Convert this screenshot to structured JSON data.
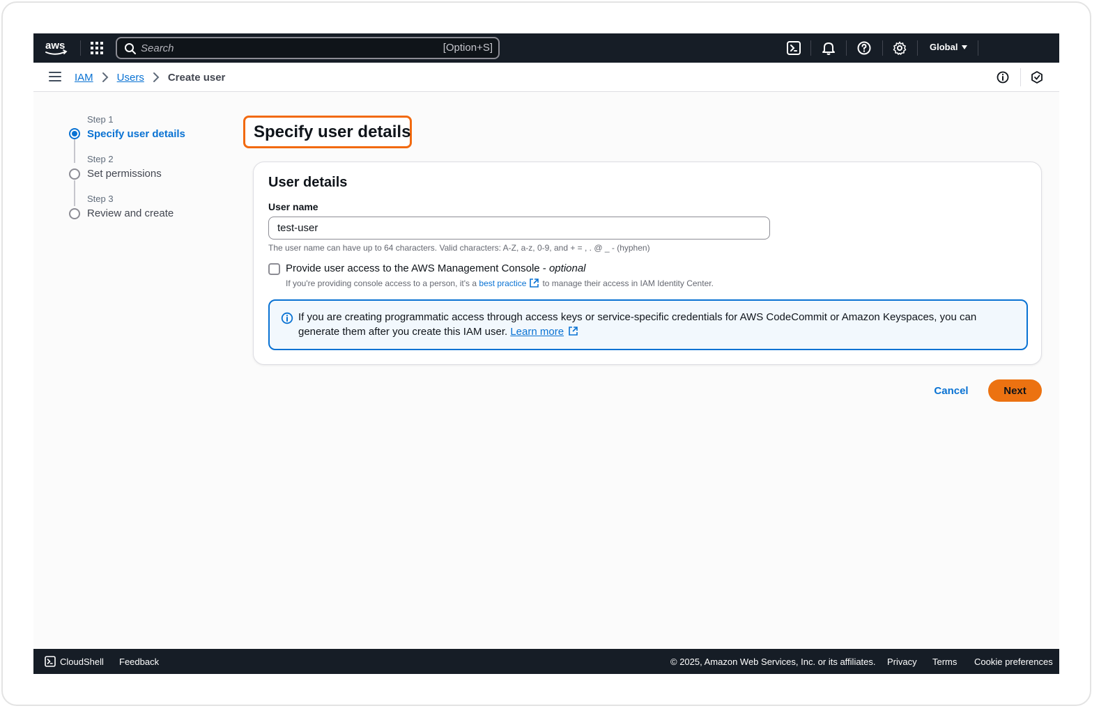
{
  "nav": {
    "logo_text": "aws",
    "search_placeholder": "Search",
    "search_shortcut": "[Option+S]",
    "region": "Global"
  },
  "breadcrumb": {
    "items": [
      "IAM",
      "Users"
    ],
    "current": "Create user"
  },
  "steps": [
    {
      "step": "Step 1",
      "title": "Specify user details",
      "active": true
    },
    {
      "step": "Step 2",
      "title": "Set permissions",
      "active": false
    },
    {
      "step": "Step 3",
      "title": "Review and create",
      "active": false
    }
  ],
  "page_title": "Specify user details",
  "form": {
    "section_title": "User details",
    "user_name_label": "User name",
    "user_name_value": "test-user",
    "user_name_hint": "The user name can have up to 64 characters. Valid characters: A-Z, a-z, 0-9, and + = , . @ _ - (hyphen)",
    "console_access_label": "Provide user access to the AWS Management Console - ",
    "console_access_optional": "optional",
    "console_access_checked": false,
    "console_desc_before": "If you're providing console access to a person, it's a",
    "console_desc_link": "best practice",
    "console_desc_after": "to manage their access in IAM Identity Center."
  },
  "alert": {
    "text": "If you are creating programmatic access through access keys or service-specific credentials for AWS CodeCommit or Amazon Keyspaces, you can generate them after you create this IAM user.",
    "link": "Learn more"
  },
  "actions": {
    "cancel": "Cancel",
    "next": "Next"
  },
  "footer": {
    "cloudshell": "CloudShell",
    "feedback": "Feedback",
    "copyright": "© 2025, Amazon Web Services, Inc. or its affiliates.",
    "privacy": "Privacy",
    "terms": "Terms",
    "cookies": "Cookie preferences"
  },
  "colors": {
    "nav_bg": "#161d26",
    "link_blue": "#0972d3",
    "accent_orange": "#ec7211",
    "highlight_orange": "#f26a10"
  }
}
